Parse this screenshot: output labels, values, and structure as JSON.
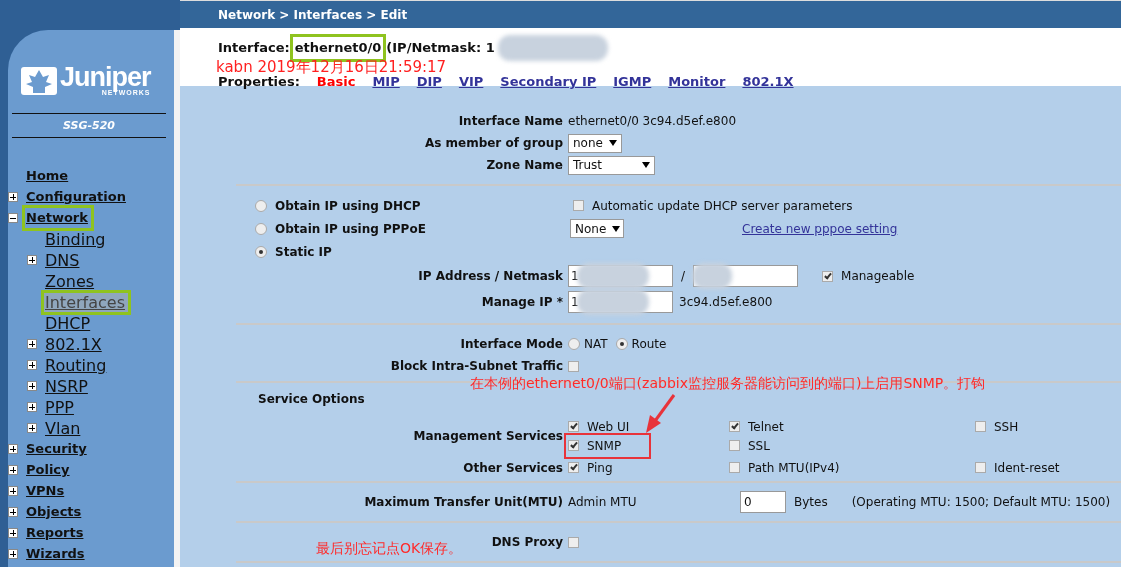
{
  "sidebar": {
    "logo": {
      "name": "Juniper",
      "tagline": "NETWORKS"
    },
    "model": "SSG-520",
    "nav": [
      {
        "label": "Home",
        "selected": false,
        "highlighted": false
      },
      {
        "label": "Configuration",
        "expanded": false,
        "selected": false,
        "highlighted": false
      },
      {
        "label": "Network",
        "expanded": true,
        "selected": false,
        "highlighted": true,
        "children": [
          {
            "label": "Binding",
            "selected": false,
            "highlighted": false
          },
          {
            "label": "DNS",
            "expanded": false,
            "selected": false,
            "highlighted": false
          },
          {
            "label": "Zones",
            "selected": false,
            "highlighted": false
          },
          {
            "label": "Interfaces",
            "selected": true,
            "highlighted": true
          },
          {
            "label": "DHCP",
            "selected": false,
            "highlighted": false
          },
          {
            "label": "802.1X",
            "expanded": false,
            "selected": false,
            "highlighted": false
          },
          {
            "label": "Routing",
            "expanded": false,
            "selected": false,
            "highlighted": false
          },
          {
            "label": "NSRP",
            "expanded": false,
            "selected": false,
            "highlighted": false
          },
          {
            "label": "PPP",
            "expanded": false,
            "selected": false,
            "highlighted": false
          },
          {
            "label": "Vlan",
            "expanded": false,
            "selected": false,
            "highlighted": false
          }
        ]
      },
      {
        "label": "Security",
        "expanded": false,
        "selected": false,
        "highlighted": false
      },
      {
        "label": "Policy",
        "expanded": false,
        "selected": false,
        "highlighted": false
      },
      {
        "label": "VPNs",
        "expanded": false,
        "selected": false,
        "highlighted": false
      },
      {
        "label": "Objects",
        "expanded": false,
        "selected": false,
        "highlighted": false
      },
      {
        "label": "Reports",
        "expanded": false,
        "selected": false,
        "highlighted": false
      },
      {
        "label": "Wizards",
        "expanded": false,
        "selected": false,
        "highlighted": false
      }
    ]
  },
  "breadcrumb": "Network > Interfaces > Edit",
  "interface": {
    "label": "Interface:",
    "name": "ethernet0/0",
    "highlighted": true,
    "ip_label": "(IP/Netmask: 1"
  },
  "timestamp": "kabn 2019年12月16日21:59:17",
  "properties": {
    "label": "Properties:",
    "tabs": [
      {
        "label": "Basic",
        "selected": true
      },
      {
        "label": "MIP",
        "selected": false
      },
      {
        "label": "DIP",
        "selected": false
      },
      {
        "label": "VIP",
        "selected": false
      },
      {
        "label": "Secondary IP",
        "selected": false
      },
      {
        "label": "IGMP",
        "selected": false
      },
      {
        "label": "Monitor",
        "selected": false
      },
      {
        "label": "802.1X",
        "selected": false
      }
    ]
  },
  "general": [
    {
      "kind": "text",
      "label": "Interface Name",
      "value": "ethernet0/0 3c94.d5ef.e800"
    },
    {
      "kind": "select",
      "label": "As member of group",
      "value": "none"
    },
    {
      "kind": "select",
      "label": "Zone Name",
      "value": "Trust"
    }
  ],
  "addressing": {
    "options": [
      {
        "label": "Obtain IP using DHCP",
        "selected": false
      },
      {
        "label": "Obtain IP using PPPoE",
        "selected": false
      },
      {
        "label": "Static IP",
        "selected": true
      }
    ],
    "dhcp_update": {
      "label": "Automatic update DHCP server parameters",
      "checked": false
    },
    "pppoe_select": "None",
    "pppoe_link": "Create new pppoe setting",
    "ip_netmask": {
      "label": "IP Address / Netmask",
      "ip": "1",
      "separator": "/",
      "manageable": {
        "label": "Manageable",
        "checked": true
      }
    },
    "manage_ip": {
      "label": "Manage IP *",
      "value": "1",
      "mac": "3c94.d5ef.e800"
    }
  },
  "mode": {
    "label": "Interface Mode",
    "options": [
      {
        "label": "NAT",
        "selected": false
      },
      {
        "label": "Route",
        "selected": true
      }
    ]
  },
  "block_intra": {
    "label": "Block Intra-Subnet Traffic",
    "checked": false
  },
  "service_options": {
    "title": "Service Options",
    "groups": [
      {
        "label": "Management Services",
        "items": [
          {
            "label": "Web UI",
            "checked": true,
            "highlighted": false
          },
          {
            "label": "Telnet",
            "checked": true,
            "highlighted": false
          },
          {
            "label": "SSH",
            "checked": false,
            "highlighted": false
          },
          {
            "label": "SNMP",
            "checked": true,
            "highlighted": true
          },
          {
            "label": "SSL",
            "checked": false,
            "highlighted": false
          }
        ]
      },
      {
        "label": "Other Services",
        "items": [
          {
            "label": "Ping",
            "checked": true,
            "highlighted": false
          },
          {
            "label": "Path MTU(IPv4)",
            "checked": false,
            "highlighted": false
          },
          {
            "label": "Ident-reset",
            "checked": false,
            "highlighted": false
          }
        ]
      }
    ]
  },
  "mtu": {
    "label": "Maximum Transfer Unit(MTU)",
    "sublabel": "Admin MTU",
    "value": "0",
    "unit": "Bytes",
    "note": "(Operating MTU: 1500; Default MTU: 1500)"
  },
  "dns_proxy": {
    "label": "DNS Proxy",
    "checked": false
  },
  "annotations": [
    {
      "text": "在本例的ethernet0/0端口(zabbix监控服务器能访问到的端口)上启用SNMP。打钩"
    },
    {
      "text": "最后别忘记点OK保存。"
    }
  ]
}
